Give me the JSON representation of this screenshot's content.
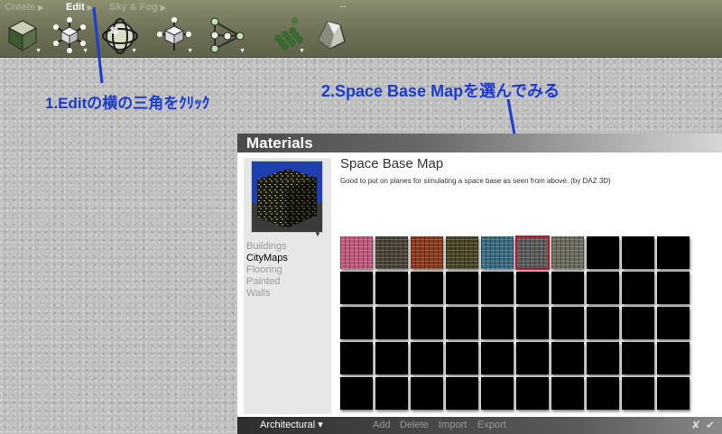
{
  "menu": {
    "create": "Create",
    "edit": "Edit",
    "sky_fog": "Sky & Fog",
    "resize_glyph": "↔"
  },
  "toolbar": {
    "tools": [
      {
        "icon": "cube-icon"
      },
      {
        "icon": "star-node-icon"
      },
      {
        "icon": "sphere-icon"
      },
      {
        "icon": "transform-cube-icon"
      },
      {
        "icon": "node-graph-icon"
      },
      {
        "icon": "grid-spheres-icon"
      },
      {
        "icon": "rock-icon"
      }
    ],
    "dropdown_glyph": "▼"
  },
  "annotations": {
    "step1": "1.Editの横の三角をｸﾘｯｸ",
    "step2": "2.Space Base Mapを選んでみる",
    "color": "#1b3bd1"
  },
  "materials": {
    "header": "Materials",
    "title": "Space Base Map",
    "description": "Good to put on planes for simulating a space base as seen from above.  (by DAZ 3D)",
    "categories": [
      "Buildings",
      "CityMaps",
      "Flooring",
      "Painted",
      "Walls"
    ],
    "selected_category": "CityMaps",
    "zoom_minus": "-",
    "zoom_plus": "+",
    "category_select": "Architectural",
    "footer": {
      "add": "Add",
      "delete": "Delete",
      "import": "Import",
      "export": "Export",
      "cancel": "✘",
      "ok": "✔"
    },
    "swatches": [
      {
        "color": "#c0587e"
      },
      {
        "color": "#4a4236"
      },
      {
        "color": "#8a3a1a"
      },
      {
        "color": "#4a4426"
      },
      {
        "color": "#3a6a80"
      },
      {
        "color": "#5a5a5a"
      },
      {
        "color": "#6a6a5e"
      }
    ],
    "selected_swatch": 5,
    "selection_color": "#c4122c"
  }
}
